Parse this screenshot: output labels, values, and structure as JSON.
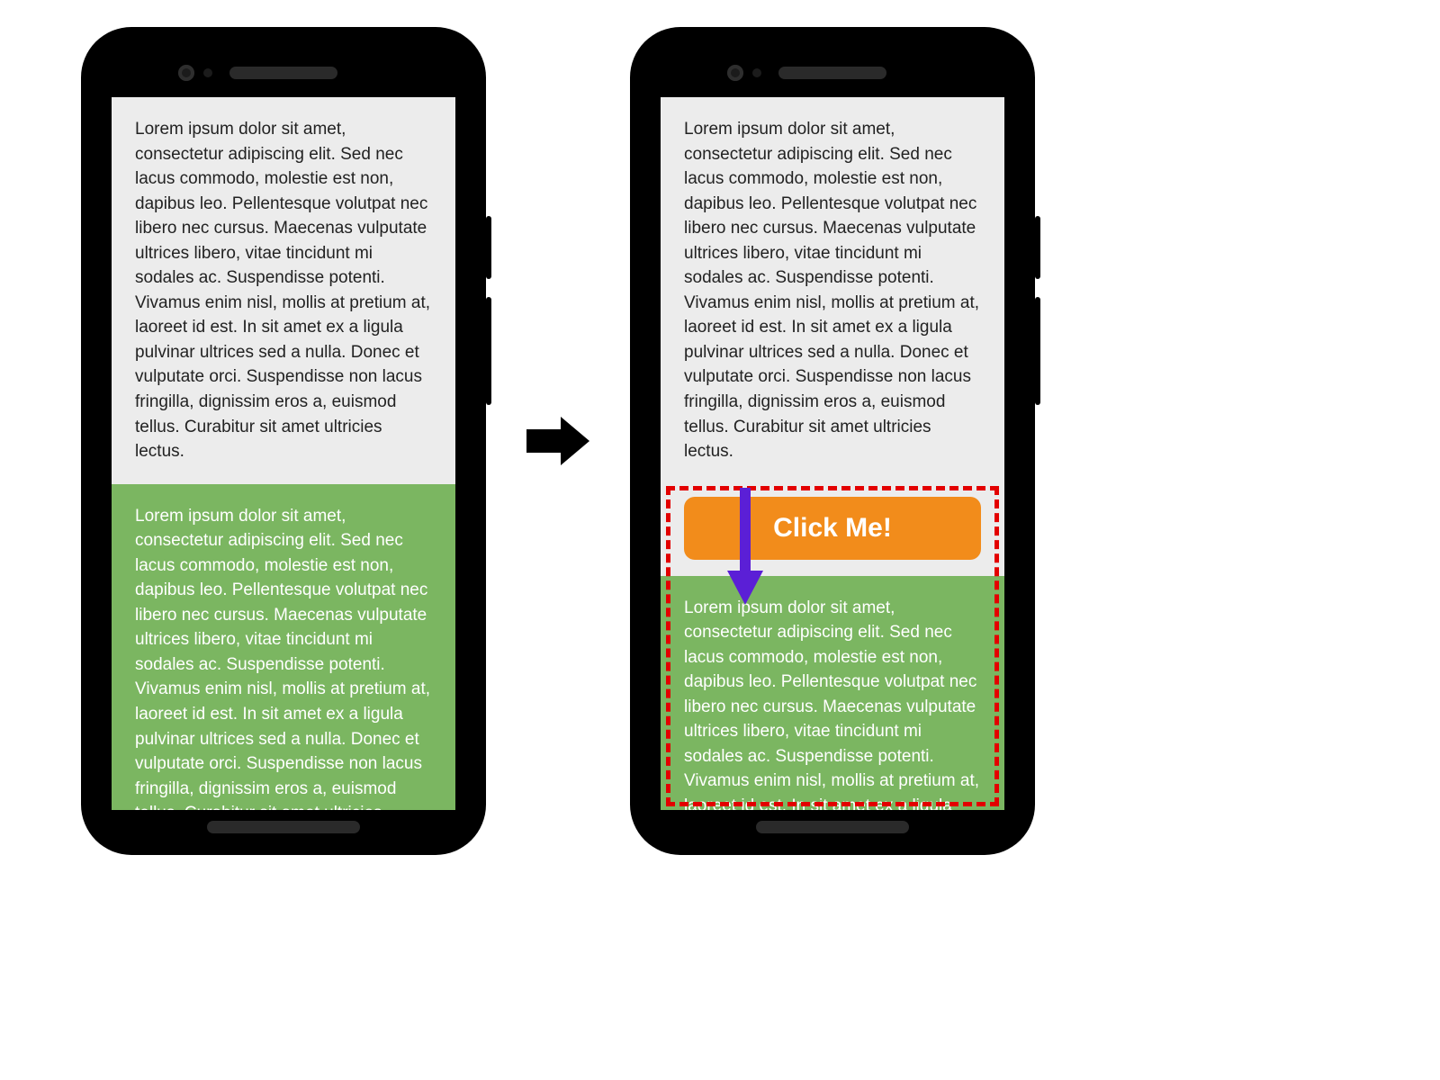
{
  "paragraph_text": "Lorem ipsum dolor sit amet, consectetur adipiscing elit. Sed nec lacus commodo, molestie est non, dapibus leo. Pellentesque volutpat nec libero nec cursus. Maecenas vulputate ultrices libero, vitae tincidunt mi sodales ac. Suspendisse potenti. Vivamus enim nisl, mollis at pretium at, laoreet id est. In sit amet ex a ligula pulvinar ultrices sed a nulla. Donec et vulputate orci. Suspendisse non lacus fringilla, dignissim eros a, euismod tellus. Curabitur sit amet ultricies lectus.",
  "paragraph_text_shifted": "Lorem ipsum dolor sit amet, consectetur adipiscing elit. Sed nec lacus commodo, molestie est non, dapibus leo. Pellentesque volutpat nec libero nec cursus. Maecenas vulputate ultrices libero, vitae tincidunt mi sodales ac. Suspendisse potenti. Vivamus enim nisl, mollis at pretium at, laoreet id est. In sit amet ex a ligula pulvinar ultrices seed.",
  "button_label": "Click Me!",
  "colors": {
    "background": "#ececec",
    "green_block": "#7bb661",
    "button": "#f28c1b",
    "shift_outline": "#e30000",
    "down_arrow": "#5b1fd6",
    "transition_arrow": "#000000"
  }
}
